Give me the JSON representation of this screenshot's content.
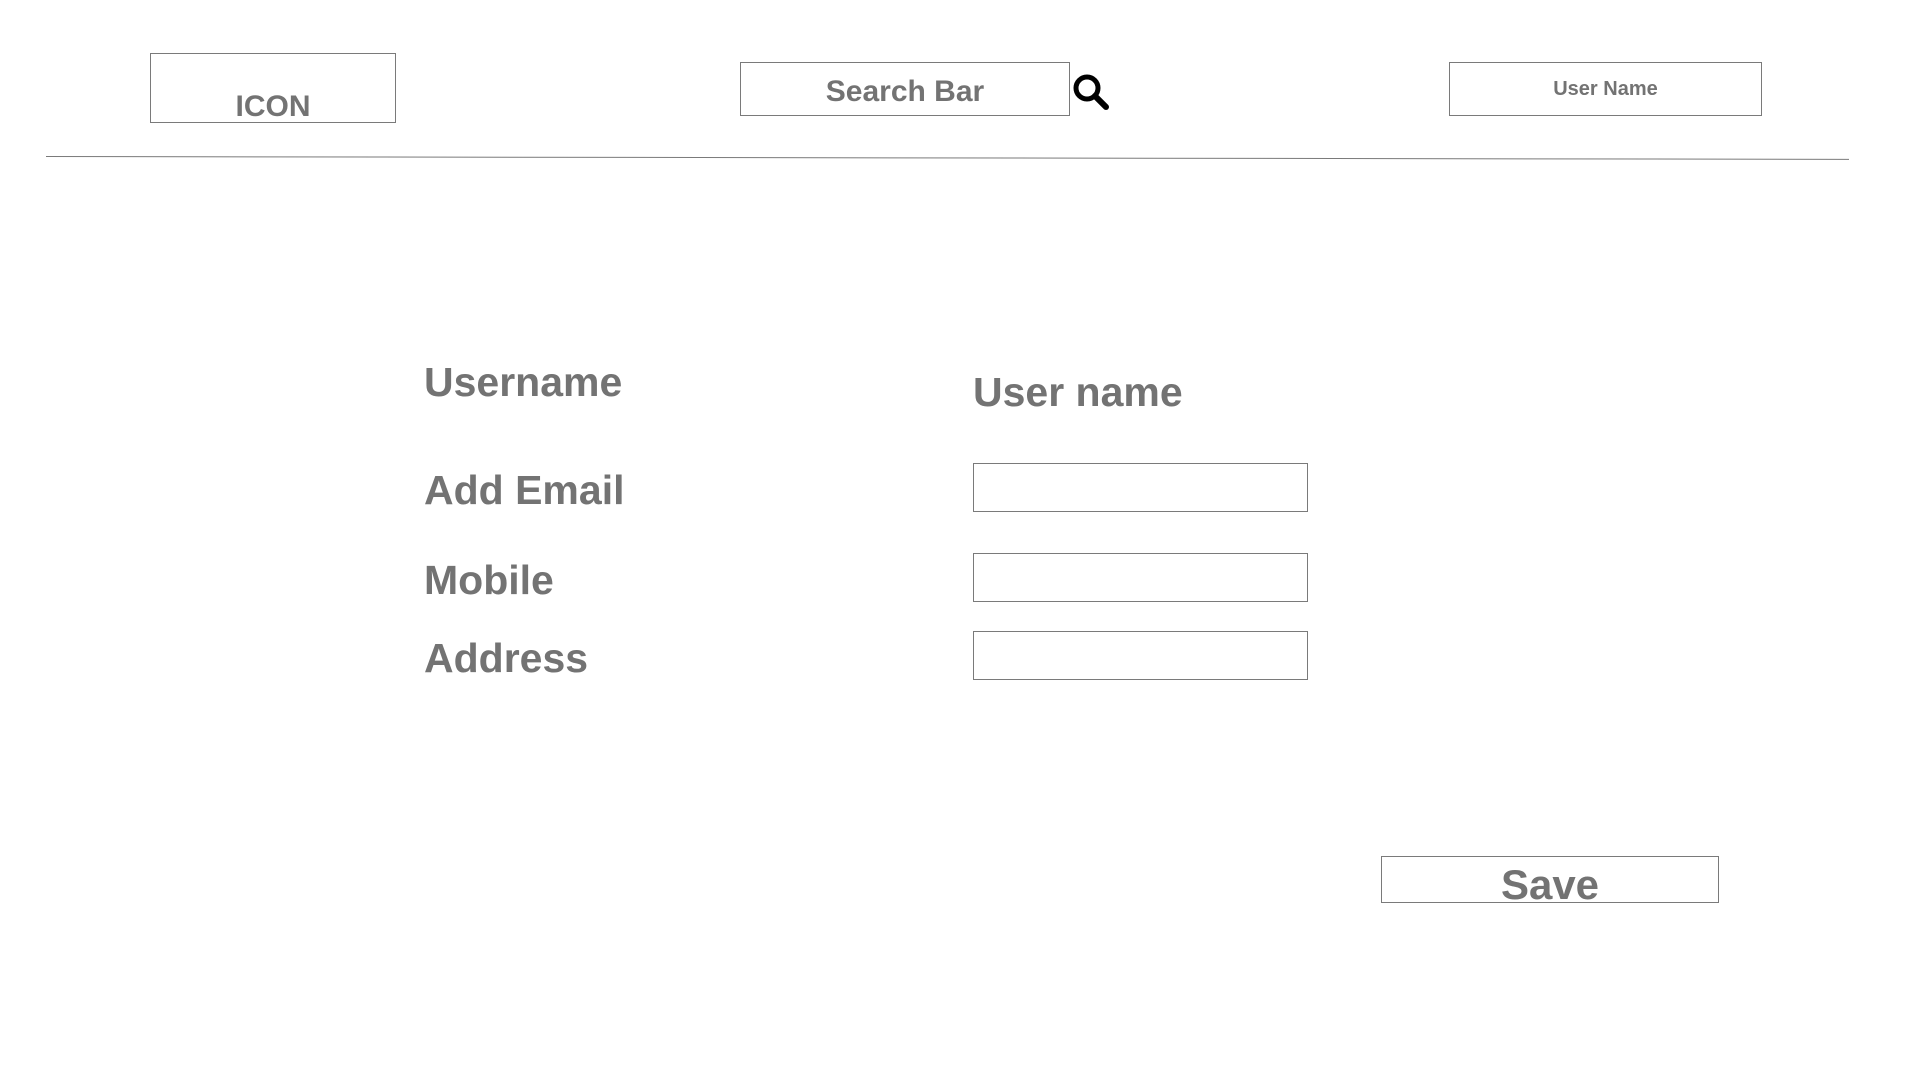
{
  "header": {
    "logo_label": "ICON",
    "search": {
      "label": "Search Bar",
      "icon": "search-icon"
    },
    "user_name_label": "User Name"
  },
  "form": {
    "username": {
      "label": "Username",
      "value": "User name"
    },
    "email": {
      "label": "Add Email",
      "value": ""
    },
    "mobile": {
      "label": "Mobile",
      "value": ""
    },
    "address": {
      "label": "Address",
      "value": ""
    },
    "save_label": "Save"
  },
  "colors": {
    "text": "#737373",
    "border": "#7a7a7a",
    "icon": "#000000",
    "background": "#ffffff"
  }
}
